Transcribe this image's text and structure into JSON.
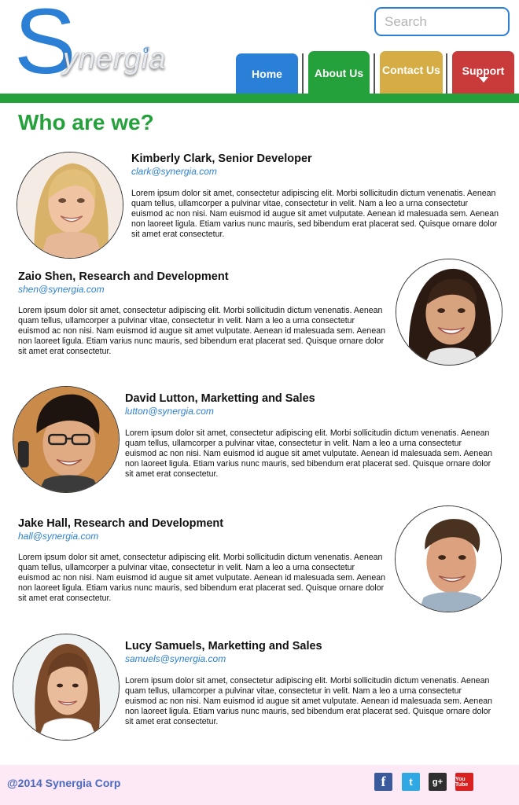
{
  "brand": {
    "logo_s": "S",
    "logo_rest": "ynergia",
    "logo_mark": "σ"
  },
  "search": {
    "placeholder": "Search",
    "value": ""
  },
  "nav": [
    {
      "label": "Home",
      "color": "#2a7fd6"
    },
    {
      "label": "About Us",
      "color": "#24a13b"
    },
    {
      "label": "Contact Us",
      "color": "#d5ad44"
    },
    {
      "label": "Support",
      "color": "#c93a3a",
      "has_dropdown": true
    }
  ],
  "page_title": "Who are we?",
  "team": [
    {
      "name": "Kimberly Clark, Senior Developer",
      "email": "clark@synergia.com",
      "bio": "Lorem ipsum dolor sit amet, consectetur adipiscing elit. Morbi sollicitudin dictum venenatis. Aenean quam tellus, ullamcorper a pulvinar vitae, consectetur in velit. Nam a leo a urna consectetur euismod ac non nisi. Nam euismod id augue sit amet vulputate. Aenean id malesuada sem. Aenean non laoreet ligula. Etiam varius nunc mauris, sed bibendum erat placerat sed. Quisque ornare dolor sit amet erat consectetur.",
      "photo": "woman-blonde-photo"
    },
    {
      "name": "Zaio Shen, Research and Development",
      "email": "shen@synergia.com",
      "bio": "Lorem ipsum dolor sit amet, consectetur adipiscing elit. Morbi sollicitudin dictum venenatis. Aenean quam tellus, ullamcorper a pulvinar vitae, consectetur in velit. Nam a leo a urna consectetur euismod ac non nisi. Nam euismod id augue sit amet vulputate. Aenean id malesuada sem. Aenean non laoreet ligula. Etiam varius nunc mauris, sed bibendum erat placerat sed. Quisque ornare dolor sit amet erat consectetur.",
      "photo": "woman-dark-hair-photo"
    },
    {
      "name": "David Lutton, Marketting and Sales",
      "email": "lutton@synergia.com",
      "bio": "Lorem ipsum dolor sit amet, consectetur adipiscing elit. Morbi sollicitudin dictum venenatis. Aenean quam tellus, ullamcorper a pulvinar vitae, consectetur in velit. Nam a leo a urna consectetur euismod ac non nisi. Nam euismod id augue sit amet vulputate. Aenean id malesuada sem. Aenean non laoreet ligula. Etiam varius nunc mauris, sed bibendum erat placerat sed. Quisque ornare dolor sit amet erat consectetur.",
      "photo": "man-glasses-photo"
    },
    {
      "name": "Jake Hall, Research and Development",
      "email": "hall@synergia.com",
      "bio": "Lorem ipsum dolor sit amet, consectetur adipiscing elit. Morbi sollicitudin dictum venenatis. Aenean quam tellus, ullamcorper a pulvinar vitae, consectetur in velit. Nam a leo a urna consectetur euismod ac non nisi. Nam euismod id augue sit amet vulputate. Aenean id malesuada sem. Aenean non laoreet ligula. Etiam varius nunc mauris, sed bibendum erat placerat sed. Quisque ornare dolor sit amet erat consectetur.",
      "photo": "man-smiling-photo"
    },
    {
      "name": "Lucy Samuels, Marketting and Sales",
      "email": "samuels@synergia.com",
      "bio": "Lorem ipsum dolor sit amet, consectetur adipiscing elit. Morbi sollicitudin dictum venenatis. Aenean quam tellus, ullamcorper a pulvinar vitae, consectetur in velit. Nam a leo a urna consectetur euismod ac non nisi. Nam euismod id augue sit amet vulputate. Aenean id malesuada sem. Aenean non laoreet ligula. Etiam varius nunc mauris, sed bibendum erat placerat sed. Quisque ornare dolor sit amet erat consectetur.",
      "photo": "woman-brown-hair-photo"
    }
  ],
  "footer": {
    "copyright": "@2014 Synergia Corp",
    "social": [
      {
        "icon": "facebook-icon",
        "glyph": "f",
        "color": "#3b5a9b"
      },
      {
        "icon": "twitter-icon",
        "glyph": "t",
        "color": "#2fa8e3"
      },
      {
        "icon": "google-plus-icon",
        "glyph": "g+",
        "color": "#2f2f2f"
      },
      {
        "icon": "youtube-icon",
        "glyph": "You Tube",
        "color": "#d92121"
      }
    ]
  }
}
